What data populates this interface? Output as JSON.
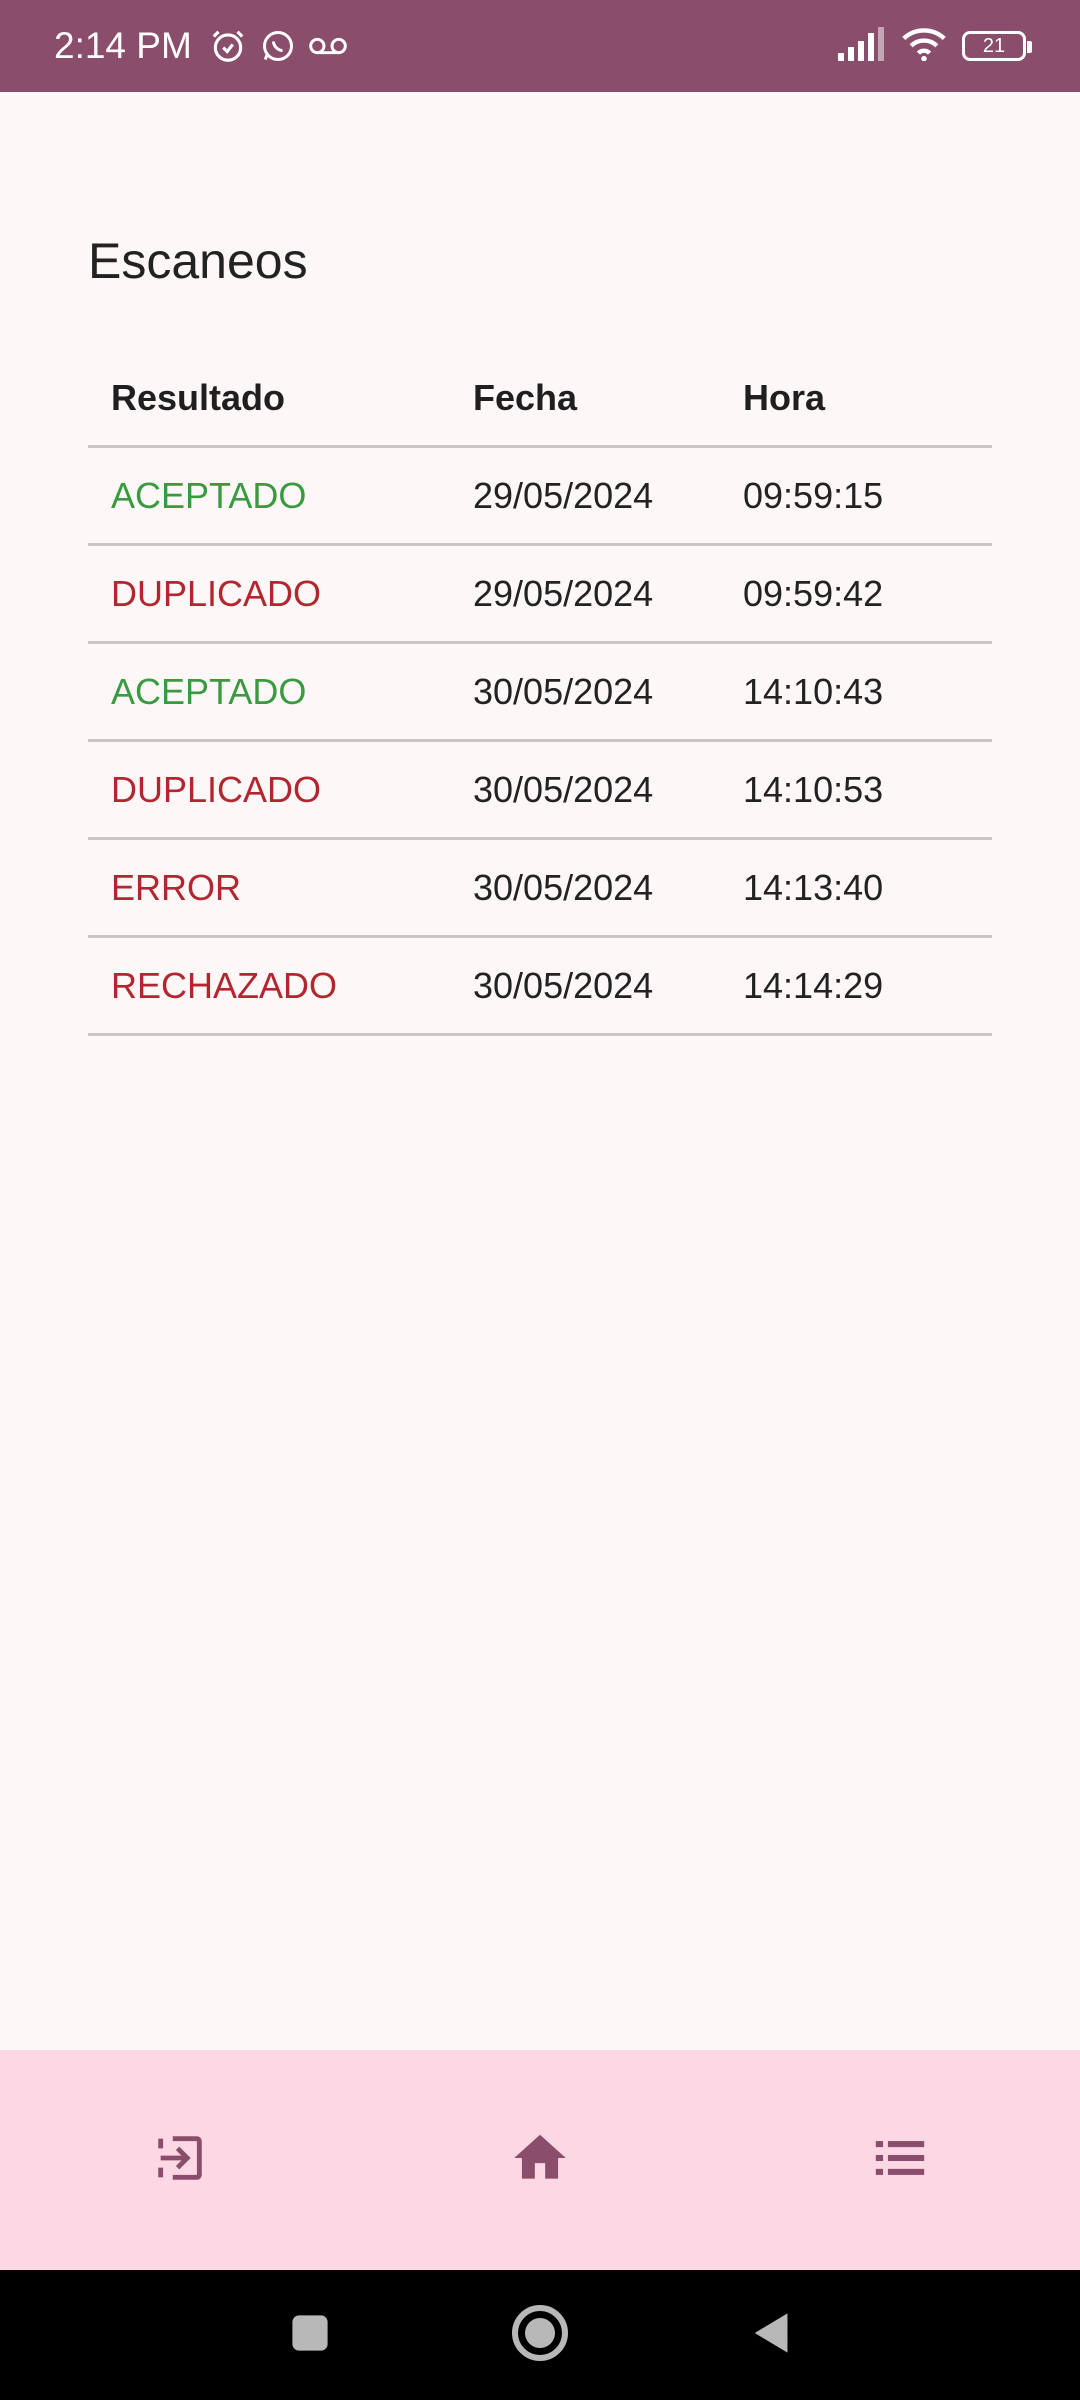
{
  "status_bar": {
    "time": "2:14 PM",
    "battery": "21",
    "icons": [
      "alarm-icon",
      "whatsapp-icon",
      "voicemail-icon",
      "signal-icon",
      "wifi-icon",
      "battery-icon"
    ]
  },
  "page": {
    "title": "Escaneos"
  },
  "table": {
    "headers": {
      "result": "Resultado",
      "date": "Fecha",
      "time": "Hora"
    },
    "rows": [
      {
        "result": "ACEPTADO",
        "date": "29/05/2024",
        "time": "09:59:15",
        "status": "green"
      },
      {
        "result": "DUPLICADO",
        "date": "29/05/2024",
        "time": "09:59:42",
        "status": "red"
      },
      {
        "result": "ACEPTADO",
        "date": "30/05/2024",
        "time": "14:10:43",
        "status": "green"
      },
      {
        "result": "DUPLICADO",
        "date": "30/05/2024",
        "time": "14:10:53",
        "status": "red"
      },
      {
        "result": "ERROR",
        "date": "30/05/2024",
        "time": "14:13:40",
        "status": "red"
      },
      {
        "result": "RECHAZADO",
        "date": "30/05/2024",
        "time": "14:14:29",
        "status": "red"
      }
    ]
  },
  "bottom_nav": {
    "items": [
      "login-icon",
      "home-icon",
      "list-icon"
    ]
  },
  "colors": {
    "primary": "#8a4d6b",
    "nav_background": "#fcd8e4",
    "accepted": "#3a9a3f",
    "rejected": "#b3262f"
  }
}
